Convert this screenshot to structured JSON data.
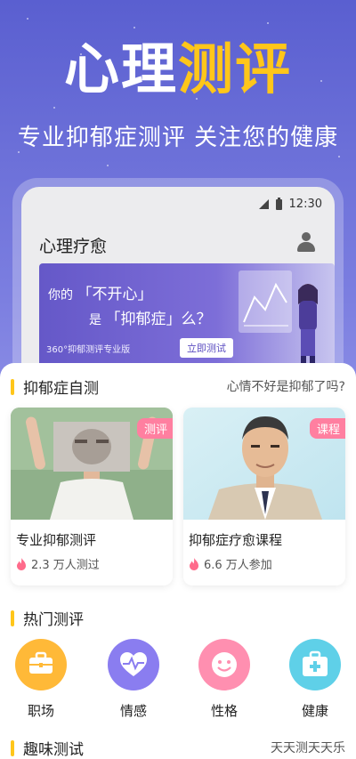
{
  "hero": {
    "title_white": "心理",
    "title_yellow": "测评",
    "subtitle": "专业抑郁症测评  关注您的健康"
  },
  "phone": {
    "time": "12:30",
    "app_title": "心理疗愈",
    "banner": {
      "line1_prefix": "你的",
      "line1_highlight": "「不开心」",
      "line2_prefix": "是",
      "line2_highlight": "「抑郁症」么？",
      "small_text": "360°抑郁测评专业版",
      "button_label": "立即测试"
    }
  },
  "self_test": {
    "title": "抑郁症自测",
    "aside": "心情不好是抑郁了吗?",
    "cards": [
      {
        "tag": "测评",
        "title": "专业抑郁测评",
        "meta": "2.3 万人测过"
      },
      {
        "tag": "课程",
        "title": "抑郁症疗愈课程",
        "meta": "6.6 万人参加"
      }
    ]
  },
  "hot": {
    "title": "热门测评",
    "categories": [
      {
        "label": "职场",
        "icon": "briefcase-icon",
        "color": "#ffb938"
      },
      {
        "label": "情感",
        "icon": "heart-pulse-icon",
        "color": "#8a7df0"
      },
      {
        "label": "性格",
        "icon": "smile-icon",
        "color": "#ff8fb0"
      },
      {
        "label": "健康",
        "icon": "medical-kit-icon",
        "color": "#5fd0e8"
      }
    ]
  },
  "fun": {
    "title": "趣味测试",
    "aside": "天天测天天乐"
  },
  "colors": {
    "accent_yellow": "#ffc61a",
    "hero_purple": "#5a5fd0",
    "tag_pink": "#ff7fa0"
  }
}
